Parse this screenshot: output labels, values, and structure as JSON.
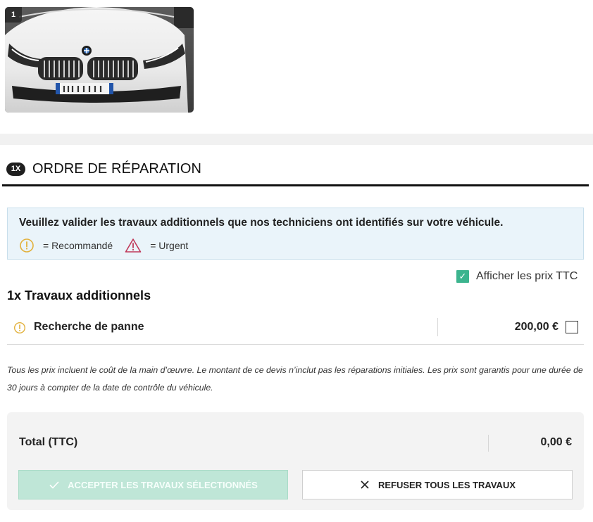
{
  "photo": {
    "badge": "1"
  },
  "order": {
    "quantity_badge": "1X",
    "title": "ORDRE DE RÉPARATION"
  },
  "info": {
    "message": "Veuillez valider les travaux additionnels que nos techniciens ont identifiés sur votre véhicule.",
    "legend_recommended": "= Recommandé",
    "legend_urgent": "= Urgent"
  },
  "price_toggle": {
    "label": "Afficher les prix TTC",
    "checked": true,
    "check_glyph": "✓"
  },
  "section": {
    "title": "1x Travaux additionnels"
  },
  "jobs": [
    {
      "name": "Recherche de panne",
      "price": "200,00 €",
      "level": "recommended",
      "selected": false
    }
  ],
  "disclaimer": "Tous les prix incluent le coût de la main d’œuvre. Le montant de ce devis n’inclut pas les réparations initiales. Les prix sont garantis pour une durée de 30 jours à compter de la date de contrôle du véhicule.",
  "total": {
    "label": "Total (TTC)",
    "value": "0,00 €"
  },
  "buttons": {
    "accept": "ACCEPTER LES TRAVAUX SÉLECTIONNÉS",
    "refuse": "REFUSER TOUS LES TRAVAUX"
  },
  "colors": {
    "accent_green": "#3cb48e",
    "accept_disabled": "#bfe6d7",
    "recommended_icon": "#e2b13c",
    "urgent_icon": "#c0395a",
    "info_bg": "#eaf4fa"
  }
}
